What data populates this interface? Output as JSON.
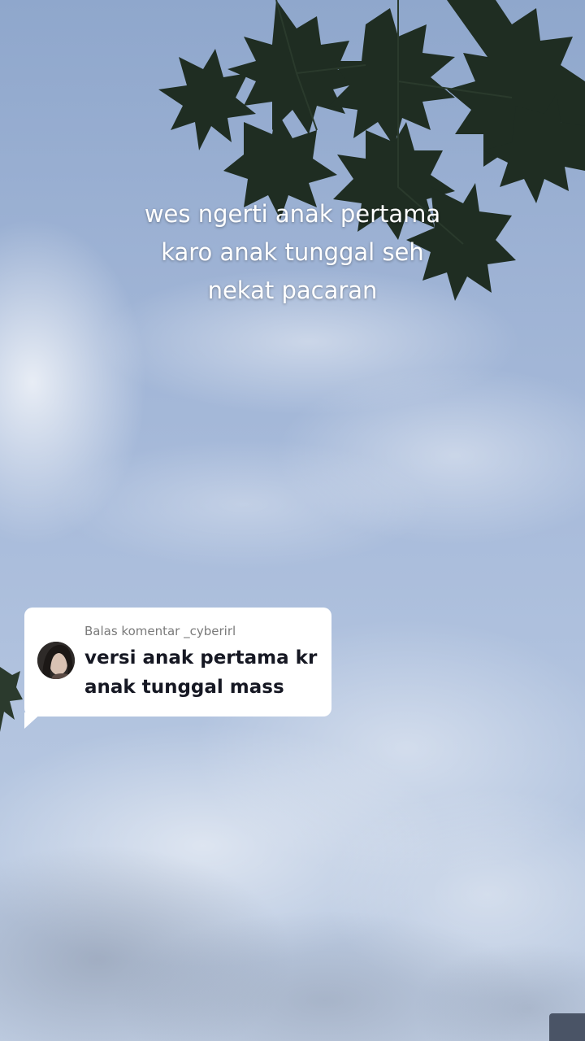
{
  "video": {
    "caption_lines": [
      "wes ngerti anak pertama",
      "karo anak tunggal seh",
      "nekat pacaran"
    ]
  },
  "reply": {
    "header": "Balas komentar _cyberirl",
    "comment_lines": [
      "versi anak pertama kr",
      "anak tunggal mass"
    ]
  },
  "colors": {
    "sky_top": "#8fa7cc",
    "sky_bottom": "#c0cee3",
    "leaf": "#1f2d22",
    "bubble_bg": "#ffffff",
    "comment_text": "#161823",
    "header_text": "#7a7a7a"
  }
}
